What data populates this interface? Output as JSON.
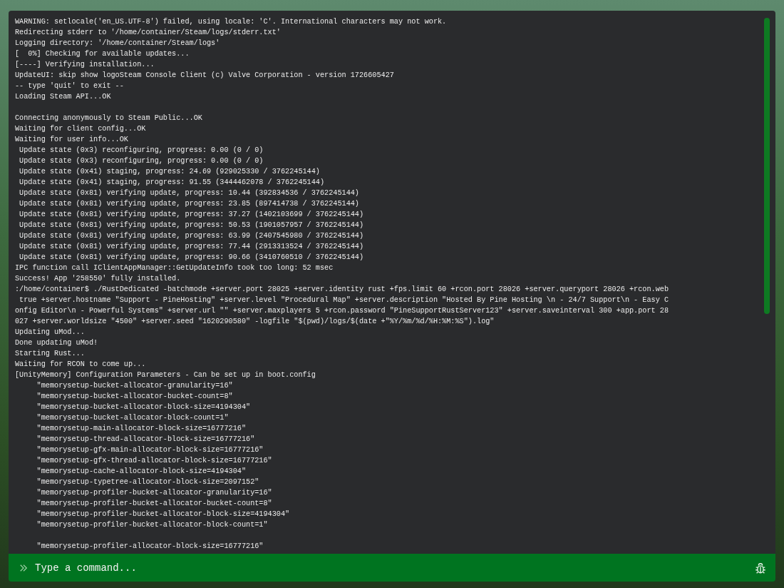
{
  "console": {
    "blocks": [
      [
        "WARNING: setlocale('en_US.UTF-8') failed, using locale: 'C'. International characters may not work.",
        "Redirecting stderr to '/home/container/Steam/logs/stderr.txt'",
        "Logging directory: '/home/container/Steam/logs'",
        "[  0%] Checking for available updates...",
        "[----] Verifying installation...",
        "UpdateUI: skip show logoSteam Console Client (c) Valve Corporation - version 1726605427",
        "-- type 'quit' to exit --",
        "Loading Steam API...OK"
      ],
      [
        "Connecting anonymously to Steam Public...OK",
        "Waiting for client config...OK",
        "Waiting for user info...OK",
        " Update state (0x3) reconfiguring, progress: 0.00 (0 / 0)",
        " Update state (0x3) reconfiguring, progress: 0.00 (0 / 0)",
        " Update state (0x41) staging, progress: 24.69 (929025330 / 3762245144)",
        " Update state (0x41) staging, progress: 91.55 (3444462078 / 3762245144)",
        " Update state (0x81) verifying update, progress: 10.44 (392834536 / 3762245144)",
        " Update state (0x81) verifying update, progress: 23.85 (897414738 / 3762245144)",
        " Update state (0x81) verifying update, progress: 37.27 (1402103699 / 3762245144)",
        " Update state (0x81) verifying update, progress: 50.53 (1901057957 / 3762245144)",
        " Update state (0x81) verifying update, progress: 63.99 (2407545980 / 3762245144)",
        " Update state (0x81) verifying update, progress: 77.44 (2913313524 / 3762245144)",
        " Update state (0x81) verifying update, progress: 90.66 (3410760510 / 3762245144)",
        "IPC function call IClientAppManager::GetUpdateInfo took too long: 52 msec",
        "Success! App '258550' fully installed.",
        ":/home/container$ ./RustDedicated -batchmode +server.port 28025 +server.identity rust +fps.limit 60 +rcon.port 28026 +server.queryport 28026 +rcon.web",
        " true +server.hostname \"Support - PineHosting\" +server.level \"Procedural Map\" +server.description \"Hosted By Pine Hosting \\n - 24/7 Support\\n - Easy C",
        "onfig Editor\\n - Powerful Systems\" +server.url \"\" +server.maxplayers 5 +rcon.password \"PineSupportRustServer123\" +server.saveinterval 300 +app.port 28",
        "027 +server.worldsize \"4500\" +server.seed \"1620290580\" -logfile \"$(pwd)/logs/$(date +\"%Y/%m/%d/%H:%M:%S\").log\"",
        "Updating uMod...",
        "Done updating uMod!",
        "Starting Rust...",
        "Waiting for RCON to come up...",
        "[UnityMemory] Configuration Parameters - Can be set up in boot.config",
        "     \"memorysetup-bucket-allocator-granularity=16\"",
        "     \"memorysetup-bucket-allocator-bucket-count=8\"",
        "     \"memorysetup-bucket-allocator-block-size=4194304\"",
        "     \"memorysetup-bucket-allocator-block-count=1\"",
        "     \"memorysetup-main-allocator-block-size=16777216\"",
        "     \"memorysetup-thread-allocator-block-size=16777216\"",
        "     \"memorysetup-gfx-main-allocator-block-size=16777216\"",
        "     \"memorysetup-gfx-thread-allocator-block-size=16777216\"",
        "     \"memorysetup-cache-allocator-block-size=4194304\"",
        "     \"memorysetup-typetree-allocator-block-size=2097152\"",
        "     \"memorysetup-profiler-bucket-allocator-granularity=16\"",
        "     \"memorysetup-profiler-bucket-allocator-bucket-count=8\"",
        "     \"memorysetup-profiler-bucket-allocator-block-size=4194304\"",
        "     \"memorysetup-profiler-bucket-allocator-block-count=1\""
      ],
      [
        "     \"memorysetup-profiler-allocator-block-size=16777216\""
      ]
    ]
  },
  "command_input": {
    "placeholder": "Type a command..."
  }
}
